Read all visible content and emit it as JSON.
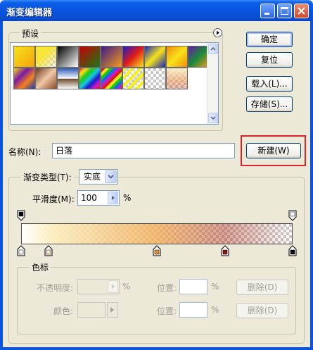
{
  "window": {
    "title": "渐变编辑器"
  },
  "presets": {
    "legend": "预设",
    "swatches": [
      {
        "name": "foreground-to-background",
        "bg": "linear-gradient(135deg,#f7e21b,#f5a30a)"
      },
      {
        "name": "foreground-to-transparent",
        "bg": "linear-gradient(135deg,#f9e43a 0%,#f9e43a 40%,rgba(249,228,58,0) 100%)",
        "checker": true
      },
      {
        "name": "black-white",
        "bg": "linear-gradient(135deg,#000,#fff)"
      },
      {
        "name": "red-green",
        "bg": "linear-gradient(135deg,#c80000,#1a7a1a)"
      },
      {
        "name": "violet-orange",
        "bg": "linear-gradient(135deg,#3a1a8a,#f59a1a)"
      },
      {
        "name": "blue-red-yellow",
        "bg": "linear-gradient(135deg,#1a1ac8,#e01a1a 50%,#f7e21b)"
      },
      {
        "name": "blue-yellow-blue",
        "bg": "linear-gradient(135deg,#1a2ab8,#f7e21b 50%,#1a2ab8)"
      },
      {
        "name": "orange-yellow-orange",
        "bg": "linear-gradient(135deg,#f58a0a,#f7e21b 50%,#f58a0a)"
      },
      {
        "name": "violet-green-orange",
        "bg": "linear-gradient(135deg,#6a1aa8,#1a8a3a 50%,#f59a1a)"
      },
      {
        "name": "yellow-violet-orange-blue",
        "bg": "linear-gradient(135deg,#f7d21b,#7a1aa8 35%,#f5801a 65%,#1a3ab8)"
      },
      {
        "name": "copper",
        "bg": "linear-gradient(135deg,#6a3a1a,#f0c8a8 50%,#8a4a2a)"
      },
      {
        "name": "chrome",
        "bg": "linear-gradient(180deg,#2a5ab8,#fff 50%,#6a4a2a 52%,#fff)"
      },
      {
        "name": "spectrum",
        "bg": "linear-gradient(135deg,#e01a1a,#f7e21b,#1ac81a,#1ac8e0,#1a1ac8,#c81ac8,#e01a1a)"
      },
      {
        "name": "transparent-rainbow",
        "bg": "repeating-linear-gradient(135deg,#e01a1a 0 4px,#f7e21b 4px 8px,#1ac81a 8px 12px,#1a6ae0 12px 16px,#c81ac8 16px 20px)"
      },
      {
        "name": "transparent-stripes",
        "bg": "repeating-linear-gradient(135deg,#f7f01b 0 4px,rgba(255,255,255,0.1) 4px 8px)",
        "checker": true
      },
      {
        "name": "transparent",
        "bg": "transparent",
        "checker": true
      },
      {
        "name": "new-preset",
        "bg": "linear-gradient(180deg,rgba(250,240,200,0.9),rgba(240,150,80,0.55) 60%,rgba(200,60,40,0.3))",
        "checker": true
      }
    ]
  },
  "buttons": {
    "ok": "确定",
    "reset": "复位",
    "load": "载入(L)...",
    "save": "存储(S)...",
    "new": "新建(W)",
    "delete_opacity": "删除(D)",
    "delete_color": "删除(D)"
  },
  "name_field": {
    "label": "名称(N):",
    "value": "日落"
  },
  "gradient_type": {
    "label": "渐变类型(T):",
    "value": "实底"
  },
  "smoothness": {
    "label": "平滑度(M):",
    "value": "100",
    "unit": "%"
  },
  "stops_group": {
    "legend": "色标",
    "opacity_label": "不透明度:",
    "opacity_unit": "%",
    "opacity_location_label": "位置:",
    "opacity_location_unit": "%",
    "color_label": "颜色:",
    "color_location_label": "位置:",
    "color_location_unit": "%"
  },
  "gradient": {
    "opacity_stops": [
      {
        "location": 0,
        "color": "#000000"
      },
      {
        "location": 100,
        "color": "#ffffff"
      }
    ],
    "color_stops": [
      {
        "location": 0,
        "color": "#ffffff"
      },
      {
        "location": 10,
        "color": "#f7e7c4"
      },
      {
        "location": 50,
        "color": "#e8902e"
      },
      {
        "location": 75,
        "color": "#8a1a0e"
      },
      {
        "location": 100,
        "color": "#000000"
      }
    ]
  },
  "colors": {
    "highlight": "#d8232a",
    "titlebar": "#0852dc"
  }
}
